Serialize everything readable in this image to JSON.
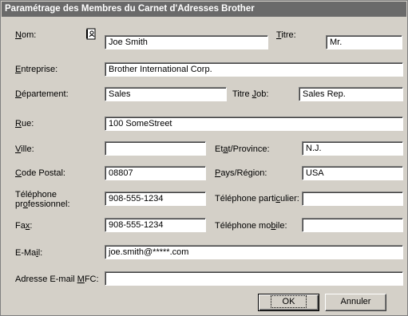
{
  "window": {
    "title": "Paramétrage des Membres du Carnet d'Adresses Brother"
  },
  "labels": {
    "nom_pre": "",
    "nom_acc": "N",
    "nom_post": "om:",
    "titre_pre": "",
    "titre_acc": "T",
    "titre_post": "itre:",
    "entreprise_pre": "",
    "entreprise_acc": "E",
    "entreprise_post": "ntreprise:",
    "departement_pre": "",
    "departement_acc": "D",
    "departement_post": "épartement:",
    "titrejob_pre": "Titre ",
    "titrejob_acc": "J",
    "titrejob_post": "ob:",
    "rue_pre": "",
    "rue_acc": "R",
    "rue_post": "ue:",
    "ville_pre": "",
    "ville_acc": "V",
    "ville_post": "ille:",
    "etat_pre": "Et",
    "etat_acc": "a",
    "etat_post": "t/Province:",
    "codepostal_pre": "",
    "codepostal_acc": "C",
    "codepostal_post": "ode Postal:",
    "pays_pre": "",
    "pays_acc": "P",
    "pays_post": "ays/Région:",
    "telpro_line1": "Téléphone",
    "telpro_pre": "pr",
    "telpro_acc": "o",
    "telpro_post": "fessionnel:",
    "telpart_pre": "Téléphone parti",
    "telpart_acc": "c",
    "telpart_post": "ulier:",
    "fax_pre": "Fa",
    "fax_acc": "x",
    "fax_post": ":",
    "telmob_pre": "Téléphone mo",
    "telmob_acc": "b",
    "telmob_post": "ile:",
    "email_pre": "E-Ma",
    "email_acc": "i",
    "email_post": "l:",
    "mfc_pre": "Adresse E-mail ",
    "mfc_acc": "M",
    "mfc_post": "FC:"
  },
  "fields": {
    "nom": "Joe Smith",
    "titre": "Mr.",
    "entreprise": "Brother International Corp.",
    "departement": "Sales",
    "titre_job": "Sales Rep.",
    "rue": "100 SomeStreet",
    "ville": "",
    "etat": "N.J.",
    "code_postal": "08807",
    "pays": "USA",
    "tel_pro": "908-555-1234",
    "tel_particulier": "",
    "fax": "908-555-1234",
    "tel_mobile": "",
    "email": "joe.smith@*****.com",
    "email_mfc": ""
  },
  "buttons": {
    "ok": "OK",
    "cancel": "Annuler"
  },
  "icons": {
    "address_book": "address-book-icon"
  }
}
